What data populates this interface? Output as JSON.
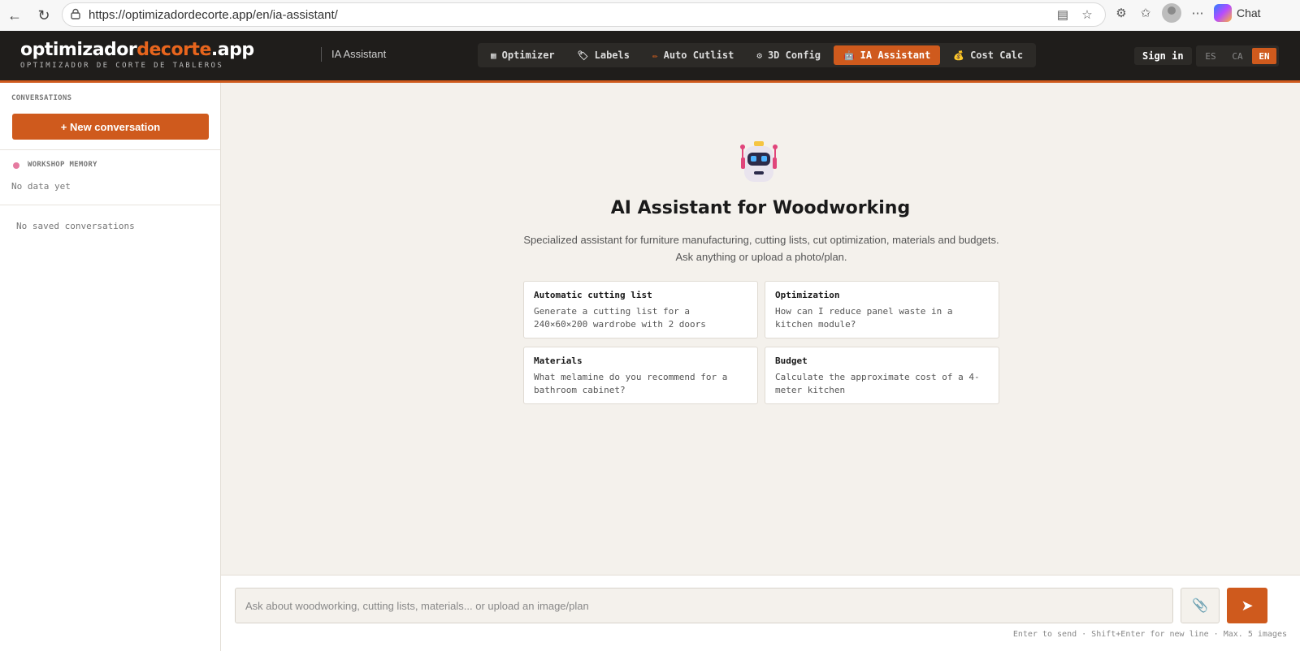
{
  "browser": {
    "url": "https://optimizadordecorte.app/en/ia-assistant/",
    "chat_label": "Chat"
  },
  "header": {
    "logo_part1": "optimizador",
    "logo_part2": "decorte",
    "logo_part3": ".app",
    "logo_sub": "OPTIMIZADOR DE CORTE DE TABLEROS",
    "section_title": "IA Assistant",
    "tabs": [
      {
        "label": "Optimizer",
        "icon": "▦"
      },
      {
        "label": "Labels",
        "icon": "🏷"
      },
      {
        "label": "Auto Cutlist",
        "icon": "✏"
      },
      {
        "label": "3D Config",
        "icon": "⚙"
      },
      {
        "label": "IA Assistant",
        "icon": "🤖"
      },
      {
        "label": "Cost Calc",
        "icon": "💰"
      }
    ],
    "sign_in": "Sign in",
    "langs": [
      "ES",
      "CA",
      "EN"
    ],
    "active_lang": "EN"
  },
  "sidebar": {
    "conversations_heading": "CONVERSATIONS",
    "new_conversation": "+ New conversation",
    "memory_heading": "WORKSHOP MEMORY",
    "memory_empty": "No data yet",
    "no_saved": "No saved conversations"
  },
  "main": {
    "title": "AI Assistant for Woodworking",
    "description": "Specialized assistant for furniture manufacturing, cutting lists, cut optimization, materials and budgets. Ask anything or upload a photo/plan.",
    "cards": [
      {
        "title": "Automatic cutting list",
        "text": "Generate a cutting list for a 240×60×200 wardrobe with 2 doors"
      },
      {
        "title": "Optimization",
        "text": "How can I reduce panel waste in a kitchen module?"
      },
      {
        "title": "Materials",
        "text": "What melamine do you recommend for a bathroom cabinet?"
      },
      {
        "title": "Budget",
        "text": "Calculate the approximate cost of a 4-meter kitchen"
      }
    ]
  },
  "input": {
    "placeholder": "Ask about woodworking, cutting lists, materials... or upload an image/plan",
    "attach_icon": "📎",
    "send_icon": "➤",
    "hint": "Enter to send · Shift+Enter for new line · Max. 5 images"
  },
  "colors": {
    "accent": "#cf5a1d",
    "header_bg": "#1f1d1b",
    "main_bg": "#f4f1ec"
  }
}
